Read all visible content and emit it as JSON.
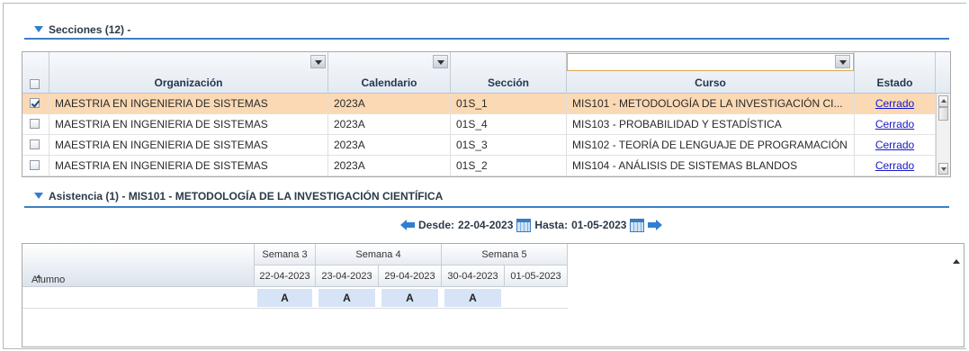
{
  "sections_panel": {
    "title": "Secciones (12) -",
    "columns": [
      "Organización",
      "Calendario",
      "Sección",
      "Curso",
      "Estado"
    ],
    "rows": [
      {
        "selected": true,
        "organizacion": "MAESTRIA EN INGENIERIA DE SISTEMAS",
        "calendario": "2023A",
        "seccion": "01S_1",
        "curso": "MIS101 - METODOLOGÍA DE LA INVESTIGACIÓN CI...",
        "estado": "Cerrado"
      },
      {
        "selected": false,
        "organizacion": "MAESTRIA EN INGENIERIA DE SISTEMAS",
        "calendario": "2023A",
        "seccion": "01S_4",
        "curso": "MIS103 - PROBABILIDAD Y ESTADÍSTICA",
        "estado": "Cerrado"
      },
      {
        "selected": false,
        "organizacion": "MAESTRIA EN INGENIERIA DE SISTEMAS",
        "calendario": "2023A",
        "seccion": "01S_3",
        "curso": "MIS102 - TEORÍA DE LENGUAJE DE PROGRAMACIÓN",
        "estado": "Cerrado"
      },
      {
        "selected": false,
        "organizacion": "MAESTRIA EN INGENIERIA DE SISTEMAS",
        "calendario": "2023A",
        "seccion": "01S_2",
        "curso": "MIS104 - ANÁLISIS DE SISTEMAS BLANDOS",
        "estado": "Cerrado"
      }
    ]
  },
  "attendance_panel": {
    "title": "Asistencia (1) - MIS101 - METODOLOGÍA DE LA INVESTIGACIÓN CIENTÍFICA",
    "date_nav": {
      "desde_label": "Desde:",
      "desde_value": "22-04-2023",
      "hasta_label": "Hasta:",
      "hasta_value": "01-05-2023"
    },
    "alumno_header": "Alumno",
    "weeks": [
      "Semana 3",
      "Semana 4",
      "Semana 5"
    ],
    "dates": [
      "22-04-2023",
      "23-04-2023",
      "29-04-2023",
      "30-04-2023",
      "01-05-2023"
    ],
    "marks": [
      "A",
      "A",
      "A",
      "A",
      ""
    ]
  },
  "colors": {
    "accent": "#3d7fc6",
    "selected_row": "#fbd9b4",
    "link": "#1818c8",
    "attendance_cell": "#d7e4f7"
  },
  "icons": [
    "collapse-triangle-icon",
    "dropdown-arrow-icon",
    "checkbox-icon",
    "calendar-icon",
    "left-arrow-icon",
    "right-arrow-icon",
    "sort-up-icon"
  ]
}
